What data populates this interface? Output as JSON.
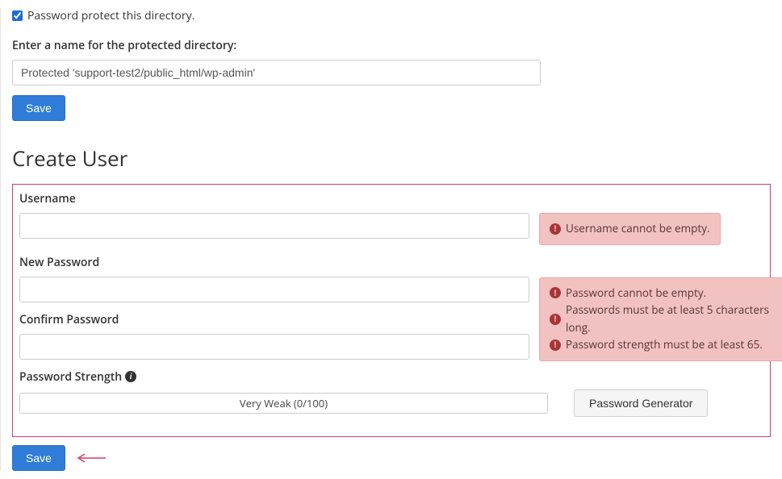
{
  "protect": {
    "checkbox_label": "Password protect this directory.",
    "checked": true,
    "name_label": "Enter a name for the protected directory:",
    "name_value": "Protected 'support-test2/public_html/wp-admin'",
    "save_label": "Save"
  },
  "create_user": {
    "heading": "Create User",
    "username_label": "Username",
    "username_value": "",
    "username_error": "Username cannot be empty.",
    "new_password_label": "New Password",
    "new_password_value": "",
    "password_errors": [
      "Password cannot be empty.",
      "Passwords must be at least 5 characters long.",
      "Password strength must be at least 65."
    ],
    "confirm_password_label": "Confirm Password",
    "confirm_password_value": "",
    "strength_label": "Password Strength",
    "strength_text": "Very Weak (0/100)",
    "generator_label": "Password Generator",
    "save_label": "Save"
  }
}
